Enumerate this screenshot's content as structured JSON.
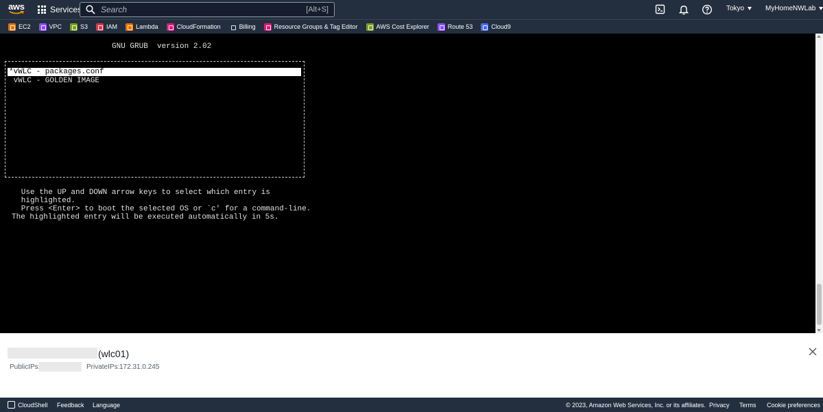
{
  "topbar": {
    "logo_text": "aws",
    "services_label": "Services",
    "search_placeholder": "Search",
    "search_shortcut": "[Alt+S]",
    "region": "Tokyo",
    "account": "MyHomeNWLab",
    "icons": [
      "cloudshell-icon",
      "bell-icon",
      "help-icon"
    ]
  },
  "favorites": [
    {
      "label": "EC2",
      "color": "#ed7100"
    },
    {
      "label": "VPC",
      "color": "#8c4fff"
    },
    {
      "label": "S3",
      "color": "#7aa116"
    },
    {
      "label": "IAM",
      "color": "#dd344c"
    },
    {
      "label": "Lambda",
      "color": "#ed7100"
    },
    {
      "label": "CloudFormation",
      "color": "#e7157b"
    },
    {
      "label": "Billing",
      "color": "#232f3e"
    },
    {
      "label": "Resource Groups & Tag Editor",
      "color": "#e7157b"
    },
    {
      "label": "AWS Cost Explorer",
      "color": "#7aa116"
    },
    {
      "label": "Route 53",
      "color": "#8c4fff"
    },
    {
      "label": "Cloud9",
      "color": "#4a6cf7"
    }
  ],
  "terminal": {
    "grub_title": "GNU GRUB  version 2.02",
    "entries": [
      "*vWLC - packages.conf",
      " vWLC - GOLDEN IMAGE"
    ],
    "help_lines": [
      "   Use the UP and DOWN arrow keys to select which entry is",
      "   highlighted.",
      "   Press <Enter> to boot the selected OS or `c' for a command-line.",
      "The highlighted entry will be executed automatically in 5s."
    ]
  },
  "instance": {
    "name_suffix": "(wlc01)",
    "public_ips_label": "PublicIPs:",
    "private_ips_label": "PrivateIPs:",
    "private_ip": "172.31.0.245"
  },
  "footer": {
    "cloudshell": "CloudShell",
    "feedback": "Feedback",
    "language": "Language",
    "copyright": "© 2023, Amazon Web Services, Inc. or its affiliates.",
    "privacy": "Privacy",
    "terms": "Terms",
    "cookie": "Cookie preferences"
  }
}
